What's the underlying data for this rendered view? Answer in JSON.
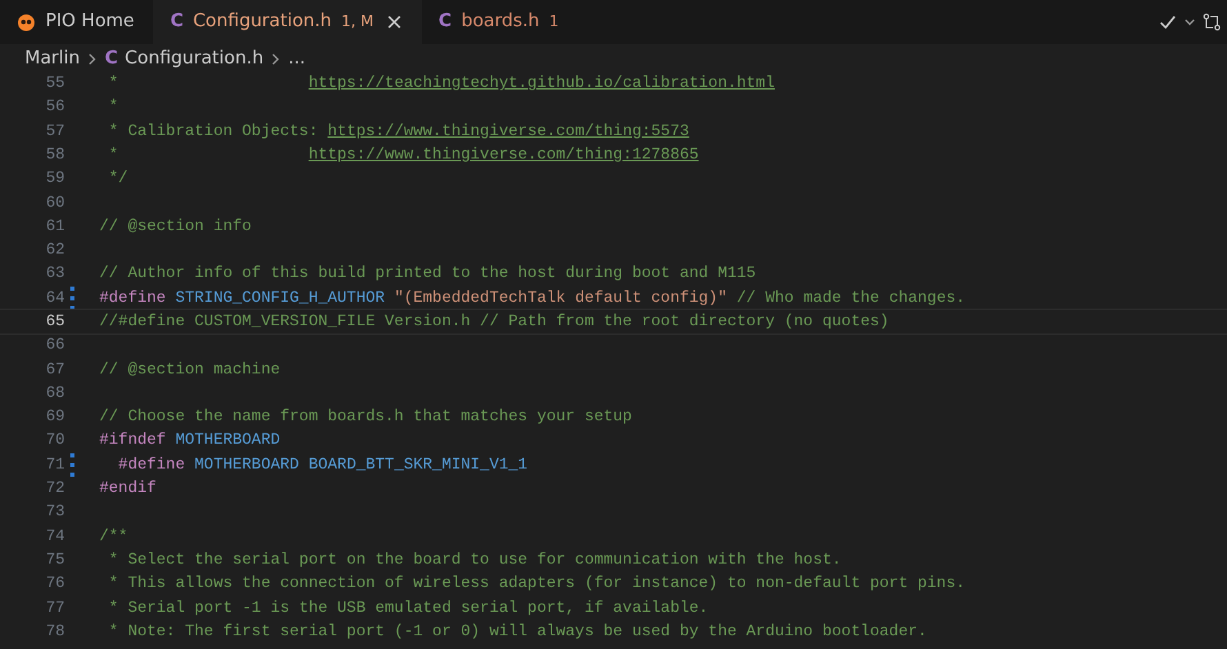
{
  "tabs": [
    {
      "kind": "pio",
      "label": "PIO Home",
      "selected": false
    },
    {
      "kind": "c",
      "icon": "C",
      "label": "Configuration.h",
      "badge": "1, M",
      "selected": true
    },
    {
      "kind": "c",
      "icon": "C",
      "label": "boards.h",
      "badge": "1",
      "selected": false
    }
  ],
  "breadcrumb": [
    {
      "label": "Marlin"
    },
    {
      "icon": "C",
      "label": "Configuration.h"
    },
    {
      "label": "..."
    }
  ],
  "editor": {
    "lines": [
      {
        "number": "55",
        "modified": false,
        "current": false,
        "tokens": [
          {
            "kind": "comment",
            "text": " *                    "
          },
          {
            "kind": "link",
            "text": "https://teachingtechyt.github.io/calibration.html"
          }
        ]
      },
      {
        "number": "56",
        "modified": false,
        "current": false,
        "tokens": [
          {
            "kind": "comment",
            "text": " *"
          }
        ]
      },
      {
        "number": "57",
        "modified": false,
        "current": false,
        "tokens": [
          {
            "kind": "comment",
            "text": " * Calibration Objects: "
          },
          {
            "kind": "link",
            "text": "https://www.thingiverse.com/thing:5573"
          }
        ]
      },
      {
        "number": "58",
        "modified": false,
        "current": false,
        "tokens": [
          {
            "kind": "comment",
            "text": " *                    "
          },
          {
            "kind": "link",
            "text": "https://www.thingiverse.com/thing:1278865"
          }
        ]
      },
      {
        "number": "59",
        "modified": false,
        "current": false,
        "tokens": [
          {
            "kind": "comment",
            "text": " */"
          }
        ]
      },
      {
        "number": "60",
        "modified": false,
        "current": false
      },
      {
        "number": "61",
        "modified": false,
        "current": false,
        "tokens": [
          {
            "kind": "comment",
            "text": "// @section info"
          }
        ]
      },
      {
        "number": "62",
        "modified": false,
        "current": false
      },
      {
        "number": "63",
        "modified": false,
        "current": false,
        "tokens": [
          {
            "kind": "comment",
            "text": "// Author info of this build printed to the host during boot and M115"
          }
        ]
      },
      {
        "number": "64",
        "modified": true,
        "current": false,
        "tokens": [
          {
            "kind": "keyword",
            "text": "#define"
          },
          {
            "kind": "macro",
            "text": " STRING_CONFIG_H_AUTHOR"
          },
          {
            "kind": "string",
            "text": " \"(EmbeddedTechTalk default config)\""
          },
          {
            "kind": "comment",
            "text": " // Who made the changes."
          }
        ]
      },
      {
        "number": "65",
        "modified": false,
        "current": true,
        "tokens": [
          {
            "kind": "comment",
            "text": "//#define CUSTOM_VERSION_FILE Version.h // Path from the root directory (no quotes)"
          }
        ]
      },
      {
        "number": "66",
        "modified": false,
        "current": false
      },
      {
        "number": "67",
        "modified": false,
        "current": false,
        "tokens": [
          {
            "kind": "comment",
            "text": "// @section machine"
          }
        ]
      },
      {
        "number": "68",
        "modified": false,
        "current": false
      },
      {
        "number": "69",
        "modified": false,
        "current": false,
        "tokens": [
          {
            "kind": "comment",
            "text": "// Choose the name from boards.h that matches your setup"
          }
        ]
      },
      {
        "number": "70",
        "modified": false,
        "current": false,
        "tokens": [
          {
            "kind": "keyword",
            "text": "#ifndef"
          },
          {
            "kind": "macro",
            "text": " MOTHERBOARD"
          }
        ]
      },
      {
        "number": "71",
        "modified": true,
        "current": false,
        "tokens": [
          {
            "kind": "keyword",
            "text": "  #define"
          },
          {
            "kind": "macro",
            "text": " MOTHERBOARD BOARD_BTT_SKR_MINI_V1_1"
          }
        ]
      },
      {
        "number": "72",
        "modified": false,
        "current": false,
        "tokens": [
          {
            "kind": "keyword",
            "text": "#endif"
          }
        ]
      },
      {
        "number": "73",
        "modified": false,
        "current": false
      },
      {
        "number": "74",
        "modified": false,
        "current": false,
        "tokens": [
          {
            "kind": "comment",
            "text": "/**"
          }
        ]
      },
      {
        "number": "75",
        "modified": false,
        "current": false,
        "tokens": [
          {
            "kind": "comment",
            "text": " * Select the serial port on the board to use for communication with the host."
          }
        ]
      },
      {
        "number": "76",
        "modified": false,
        "current": false,
        "tokens": [
          {
            "kind": "comment",
            "text": " * This allows the connection of wireless adapters (for instance) to non-default port pins."
          }
        ]
      },
      {
        "number": "77",
        "modified": false,
        "current": false,
        "tokens": [
          {
            "kind": "comment",
            "text": " * Serial port -1 is the USB emulated serial port, if available."
          }
        ]
      },
      {
        "number": "78",
        "modified": false,
        "current": false,
        "tokens": [
          {
            "kind": "comment",
            "text": " * Note: The first serial port (-1 or 0) will always be used by the Arduino bootloader."
          }
        ]
      }
    ]
  }
}
